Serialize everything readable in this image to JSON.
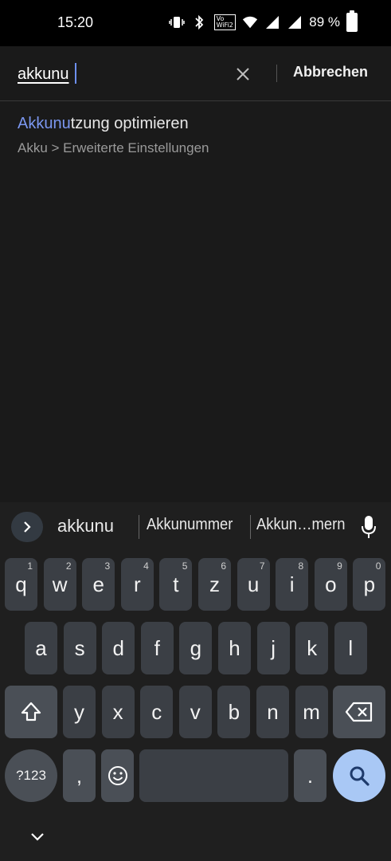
{
  "status_bar": {
    "time": "15:20",
    "volte_top": "Vo",
    "volte_bottom": "WiFi2",
    "battery_percent": "89 %"
  },
  "search": {
    "value": "akkunu",
    "cancel_label": "Abbrechen"
  },
  "result": {
    "title_highlight": "Akkunu",
    "title_rest": "tzung optimieren",
    "path": "Akku > Erweiterte Einstellungen"
  },
  "keyboard": {
    "suggestions": [
      "akkunu",
      "Akkunummer",
      "Akkun…mern"
    ],
    "row1": [
      {
        "k": "q",
        "h": "1"
      },
      {
        "k": "w",
        "h": "2"
      },
      {
        "k": "e",
        "h": "3"
      },
      {
        "k": "r",
        "h": "4"
      },
      {
        "k": "t",
        "h": "5"
      },
      {
        "k": "z",
        "h": "6"
      },
      {
        "k": "u",
        "h": "7"
      },
      {
        "k": "i",
        "h": "8"
      },
      {
        "k": "o",
        "h": "9"
      },
      {
        "k": "p",
        "h": "0"
      }
    ],
    "row2": [
      "a",
      "s",
      "d",
      "f",
      "g",
      "h",
      "j",
      "k",
      "l"
    ],
    "row3": [
      "y",
      "x",
      "c",
      "v",
      "b",
      "n",
      "m"
    ],
    "symbols_label": "?123",
    "comma": ",",
    "period": ".",
    "accent_color": "#a9c8f5"
  },
  "colors": {
    "background": "#1a1a1a",
    "highlight": "#7b97f0",
    "key": "#3b3f45"
  }
}
